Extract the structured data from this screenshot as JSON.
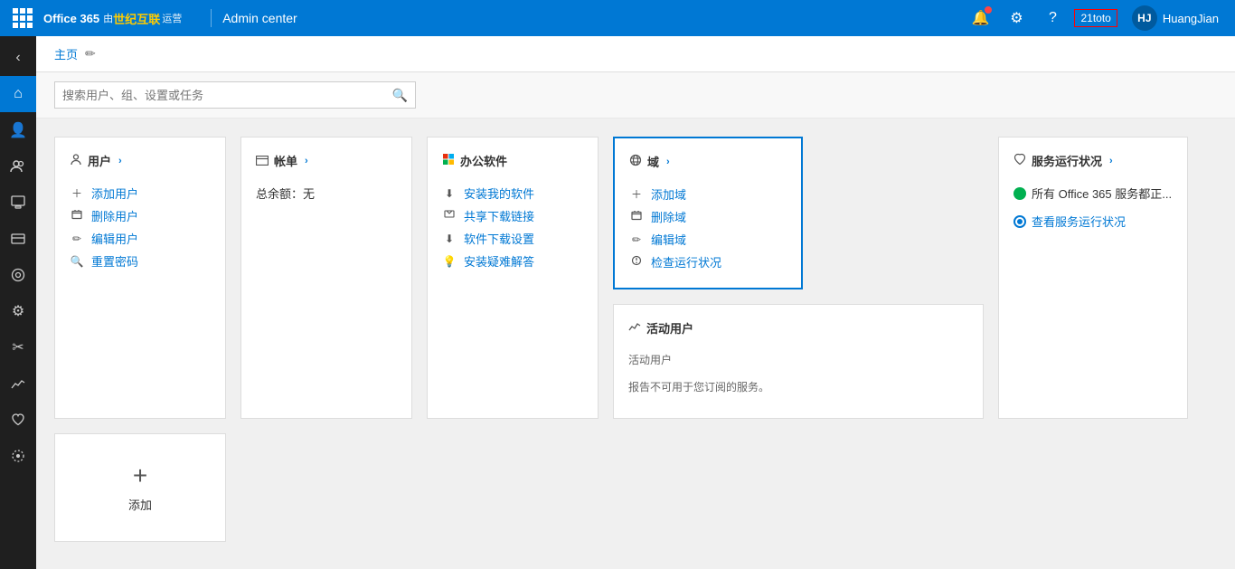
{
  "topbar": {
    "grid_icon": "grid-icon",
    "brand_office": "Office 365",
    "brand_by": "由",
    "brand_partner": "世纪互联",
    "brand_ops": "运营",
    "divider": "|",
    "admin_center": "Admin center",
    "notification_label": "bell-icon",
    "settings_label": "settings-icon",
    "help_label": "help-icon",
    "username": "HuangJian",
    "tenant_id": "21toto"
  },
  "sidebar": {
    "items": [
      {
        "icon": "‹›",
        "name": "sidebar-item-collapse",
        "label": "折叠"
      },
      {
        "icon": "⌂",
        "name": "sidebar-item-home",
        "label": "主页"
      },
      {
        "icon": "👤",
        "name": "sidebar-item-users",
        "label": "用户"
      },
      {
        "icon": "👥",
        "name": "sidebar-item-groups",
        "label": "组"
      },
      {
        "icon": "📋",
        "name": "sidebar-item-resources",
        "label": "资源"
      },
      {
        "icon": "📧",
        "name": "sidebar-item-billing",
        "label": "账单"
      },
      {
        "icon": "🛡",
        "name": "sidebar-item-support",
        "label": "支持"
      },
      {
        "icon": "⚙",
        "name": "sidebar-item-settings",
        "label": "设置"
      },
      {
        "icon": "✏",
        "name": "sidebar-item-tools",
        "label": "工具"
      },
      {
        "icon": "📊",
        "name": "sidebar-item-reports",
        "label": "报告"
      },
      {
        "icon": "♡",
        "name": "sidebar-item-health",
        "label": "运行状况"
      },
      {
        "icon": "🌐",
        "name": "sidebar-item-admin-centers",
        "label": "管理中心"
      }
    ]
  },
  "breadcrumb": {
    "home_label": "主页",
    "edit_icon": "✏"
  },
  "search": {
    "placeholder": "搜索用户、组、设置或任务"
  },
  "cards": {
    "users": {
      "header_icon": "👤",
      "title": "用户",
      "arrow": "›",
      "items": [
        {
          "icon": "+",
          "label": "添加用户"
        },
        {
          "icon": "🗑",
          "label": "删除用户"
        },
        {
          "icon": "✏",
          "label": "编辑用户"
        },
        {
          "icon": "🔍",
          "label": "重置密码"
        }
      ]
    },
    "billing": {
      "header_icon": "📋",
      "title": "帐单",
      "arrow": "›",
      "items": [
        {
          "label": "总余额：无"
        }
      ]
    },
    "office_software": {
      "header_icon": "⬛",
      "title": "办公软件",
      "items": [
        {
          "icon": "⬇",
          "label": "安装我的软件"
        },
        {
          "icon": "🖥",
          "label": "共享下载链接"
        },
        {
          "icon": "⬇",
          "label": "软件下载设置"
        },
        {
          "icon": "💡",
          "label": "安装疑难解答"
        }
      ]
    },
    "domain": {
      "header_icon": "🌐",
      "title": "域",
      "arrow": "›",
      "highlighted": true,
      "items": [
        {
          "icon": "+",
          "label": "添加域"
        },
        {
          "icon": "🗑",
          "label": "删除域"
        },
        {
          "icon": "✏",
          "label": "编辑域"
        },
        {
          "icon": "🔍",
          "label": "检查运行状况"
        }
      ]
    },
    "service_status": {
      "header_icon": "♡",
      "title": "服务运行状况",
      "arrow": "›",
      "items": [
        {
          "type": "ok",
          "label": "所有 Office 365 服务都正..."
        },
        {
          "type": "link",
          "label": "查看服务运行状况"
        }
      ]
    },
    "active_users": {
      "title": "活动用户",
      "subtitle": "活动用户",
      "report_text": "报告不可用于您订阅的服务。"
    }
  },
  "add_tile": {
    "plus": "+",
    "label": "添加"
  }
}
